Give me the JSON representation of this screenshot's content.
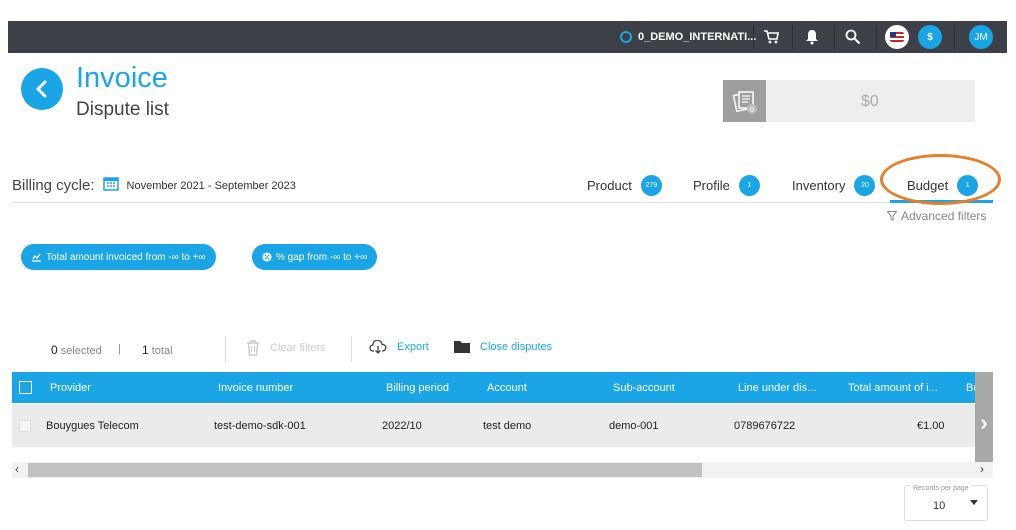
{
  "topbar": {
    "org_name": "0_DEMO_INTERNATI...",
    "currency": "$",
    "user_initials": "JM"
  },
  "header": {
    "title": "Invoice",
    "subtitle": "Dispute list",
    "total_amount": "$0",
    "total_badge": "0"
  },
  "billing": {
    "label": "Billing cycle:",
    "value": "November 2021 - September 2023"
  },
  "tabs": [
    {
      "label": "Product",
      "count": "279"
    },
    {
      "label": "Profile",
      "count": "1"
    },
    {
      "label": "Inventory",
      "count": "20"
    },
    {
      "label": "Budget",
      "count": "1"
    }
  ],
  "active_tab": "Budget",
  "advanced_filters": "Advanced filters",
  "chips": [
    {
      "label": "Total amount invoiced from -∞ to +∞"
    },
    {
      "label": "% gap from -∞ to +∞"
    }
  ],
  "selection": {
    "selected_count": "0",
    "selected_label": "selected",
    "total_count": "1",
    "total_label": "total",
    "separator": "|"
  },
  "actions": {
    "clear_filters": "Clear filters",
    "export": "Export",
    "close_disputes": "Close disputes"
  },
  "table": {
    "columns": [
      "Provider",
      "Invoice number",
      "Billing period",
      "Account",
      "Sub-account",
      "Line under dis...",
      "Total amount of i...",
      "Budge"
    ],
    "rows": [
      {
        "provider": "Bouygues Telecom",
        "invoice_number": "test-demo-sdk-001",
        "billing_period": "2022/10",
        "account": "test demo",
        "sub_account": "demo-001",
        "line": "0789676722",
        "total_amount": "€1.00"
      }
    ]
  },
  "pagination": {
    "records_label": "Records per page",
    "records_value": "10"
  },
  "colors": {
    "accent": "#1aa6e6",
    "topbar": "#3d4147",
    "highlight": "#e67e2a"
  }
}
